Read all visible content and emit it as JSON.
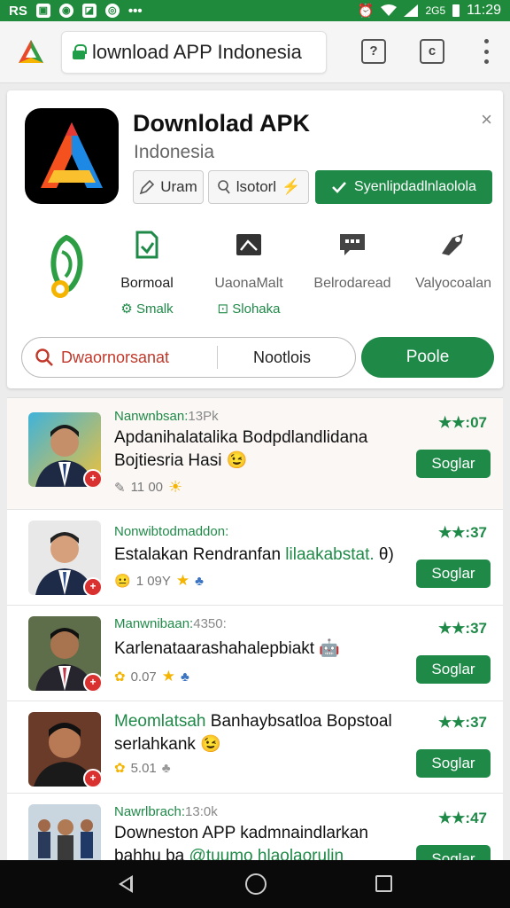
{
  "status_bar": {
    "carrier": "RS",
    "network": "2G5",
    "time": "11:29"
  },
  "browser": {
    "url": "lownload APP Indonesia",
    "tab_count": "?",
    "page_button": "c"
  },
  "app": {
    "title": "Downlolad APK",
    "subtitle": "Indonesia",
    "close": "×",
    "buttons": {
      "share_label": "Uram",
      "search_label": "lsotorl",
      "install_label": "Syenlipdadlnlaolola"
    },
    "features": [
      {
        "label": "Bormoal",
        "sub": "Smalk",
        "sub_icon": "⚙"
      },
      {
        "label": "UaonaMalt",
        "sub": "Slohaka",
        "sub_icon": "⊡"
      },
      {
        "label": "Belrodaread",
        "sub": "",
        "sub_icon": ""
      },
      {
        "label": "Valyocoalan",
        "sub": "",
        "sub_icon": ""
      }
    ],
    "search": {
      "placeholder": "Dwaornorsanat",
      "filter": "Nootlois",
      "action": "Poole"
    }
  },
  "list": [
    {
      "meta": "Nanwnbsan:",
      "meta_extra": "13Pk",
      "title": "Apdanihalatalika Bodpdlandlidana Bojtiesria Hasi",
      "emoji": "😉",
      "foot": "11 00",
      "foot_icon": "☀",
      "rating": "★★:07",
      "button": "Soglar"
    },
    {
      "meta": "Nonwibtodmaddon:",
      "meta_extra": "",
      "title_main": "Estalakan Rendranfan",
      "title_green": "lilaakabstat.",
      "title_tail": "θ)",
      "foot": "1 09Y",
      "foot_icon": "★",
      "rating": "★★:37",
      "button": "Soglar"
    },
    {
      "meta": "Manwnibaan:",
      "meta_extra": "4350:",
      "title": "Karlenataarashahalepbiakt",
      "emoji": "",
      "foot": "0.07",
      "foot_icon": "★",
      "rating": "★★:37",
      "button": "Soglar"
    },
    {
      "meta": "Meomlatsah",
      "meta_extra": "",
      "title": "Banhaybsatloa Bopstoal serlahkank",
      "emoji": "😉",
      "foot": "5.01",
      "foot_icon": "",
      "rating": "★★:37",
      "button": "Soglar"
    },
    {
      "meta": "Nawrlbrach:",
      "meta_extra": "13:0k",
      "title_main": "Downeston APP kadmnaindlarkan bahhu ba",
      "title_green": "@tuumo hlaolaorulin",
      "title_tail": "",
      "foot": "",
      "foot_icon": "",
      "rating": "★★:47",
      "button": "Soglar"
    }
  ],
  "colors": {
    "status_green": "#1f8a3c",
    "accent_green": "#1f8a48",
    "badge_red": "#d93030",
    "search_red": "#c0392b"
  },
  "icons": [
    "browser-logo-icon",
    "lock-icon",
    "search-icon",
    "close-icon",
    "check-icon",
    "star-icon",
    "back-icon",
    "home-icon",
    "recent-apps-icon"
  ]
}
